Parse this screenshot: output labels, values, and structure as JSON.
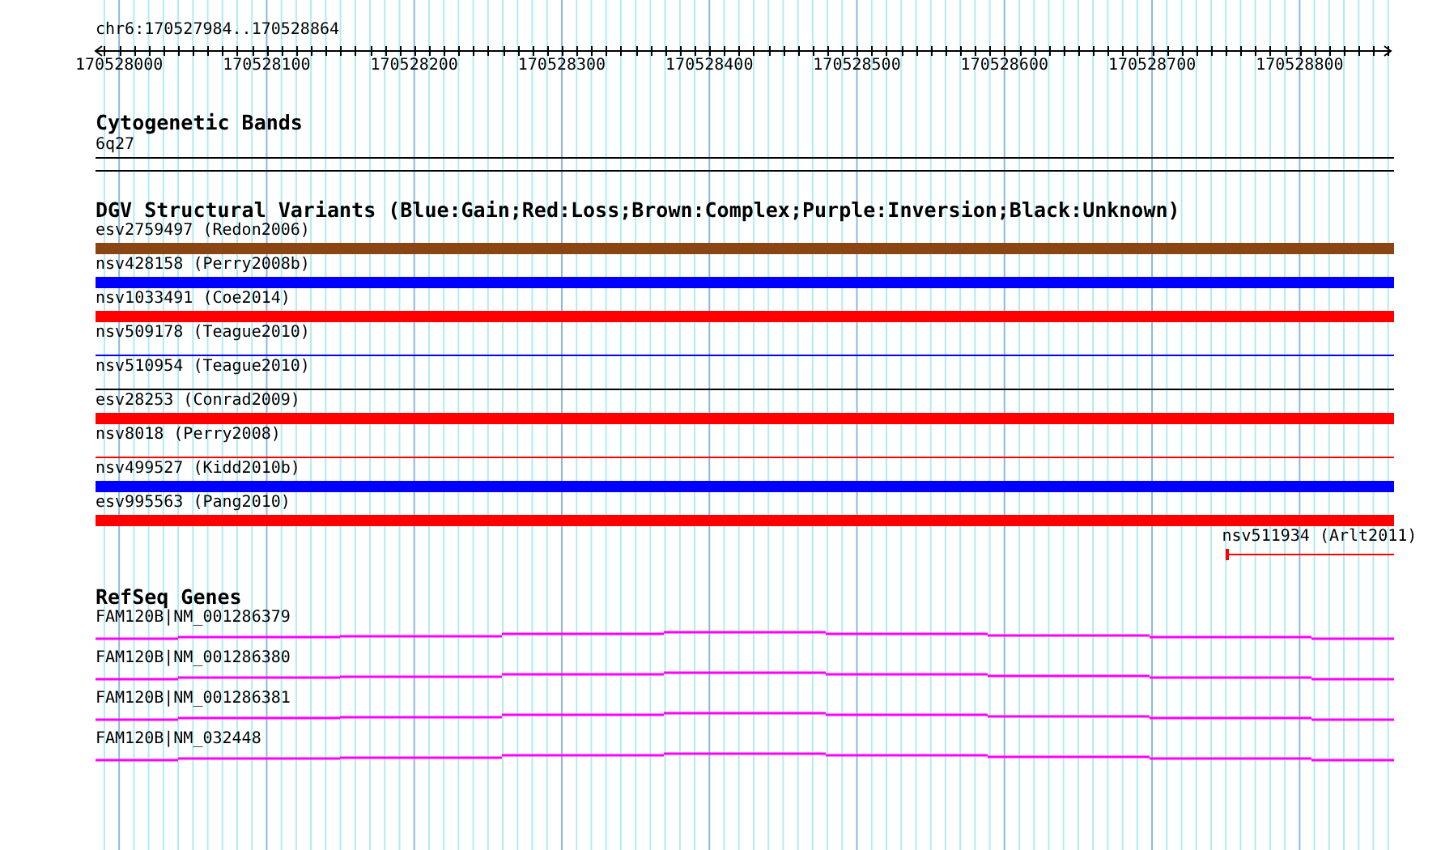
{
  "ruler": {
    "location": "chr6:170527984..170528864",
    "tick_labels": [
      "170528000",
      "170528100",
      "170528200",
      "170528300",
      "170528400",
      "170528500",
      "170528600",
      "170528700",
      "170528800"
    ]
  },
  "cytogenetic_bands": {
    "title": "Cytogenetic Bands",
    "bands": [
      {
        "label": "6q27"
      }
    ]
  },
  "dgv": {
    "title": "DGV Structural Variants (Blue:Gain;Red:Loss;Brown:Complex;Purple:Inversion;Black:Unknown)",
    "variants": [
      {
        "label": "esv2759497 (Redon2006)",
        "color": "#8b4513",
        "kind": "thick"
      },
      {
        "label": "nsv428158 (Perry2008b)",
        "color": "#0000ff",
        "kind": "thick"
      },
      {
        "label": "nsv1033491 (Coe2014)",
        "color": "#ff0000",
        "kind": "thick"
      },
      {
        "label": "nsv509178 (Teague2010)",
        "color": "#0000ff",
        "kind": "thin"
      },
      {
        "label": "nsv510954 (Teague2010)",
        "color": "#000000",
        "kind": "thin"
      },
      {
        "label": "esv28253 (Conrad2009)",
        "color": "#ff0000",
        "kind": "thick"
      },
      {
        "label": "nsv8018 (Perry2008)",
        "color": "#ff0000",
        "kind": "thin"
      },
      {
        "label": "nsv499527 (Kidd2010b)",
        "color": "#0000ff",
        "kind": "thick"
      },
      {
        "label": "esv995563 (Pang2010)",
        "color": "#ff0000",
        "kind": "thick"
      },
      {
        "label": "nsv511934 (Arlt2011)",
        "color": "#ff0000",
        "kind": "partial"
      }
    ]
  },
  "refseq": {
    "title": "RefSeq Genes",
    "genes": [
      {
        "label": "FAM120B|NM_001286379"
      },
      {
        "label": "FAM120B|NM_001286380"
      },
      {
        "label": "FAM120B|NM_001286381"
      },
      {
        "label": "FAM120B|NM_032448"
      }
    ]
  }
}
